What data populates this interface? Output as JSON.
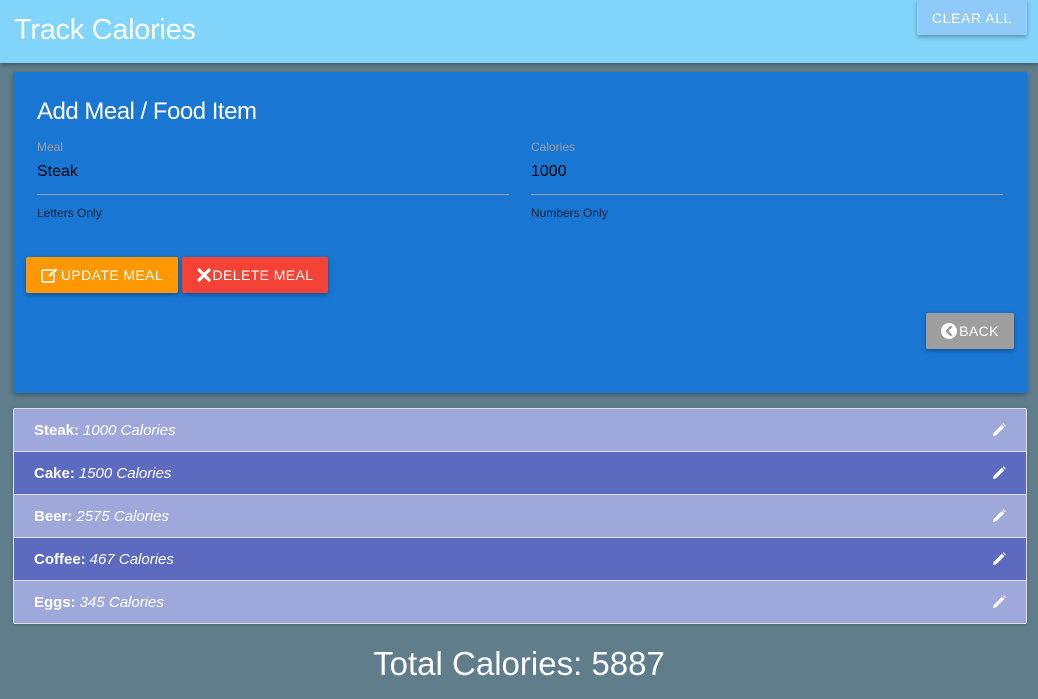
{
  "navbar": {
    "brand": "Track Calories",
    "clear_all_label": "CLEAR ALL"
  },
  "form": {
    "title": "Add Meal / Food Item",
    "meal": {
      "label": "Meal",
      "value": "Steak",
      "helper": "Letters Only"
    },
    "calories": {
      "label": "Calories",
      "value": "1000",
      "helper": "Numbers Only"
    },
    "update_label": "UPDATE MEAL",
    "delete_label": "DELETE MEAL",
    "back_label": "BACK"
  },
  "meals": [
    {
      "name": "Steak:",
      "calories": "1000 Calories"
    },
    {
      "name": "Cake:",
      "calories": "1500 Calories"
    },
    {
      "name": "Beer:",
      "calories": "2575 Calories"
    },
    {
      "name": "Coffee:",
      "calories": "467 Calories"
    },
    {
      "name": "Eggs:",
      "calories": "345 Calories"
    }
  ],
  "total_label": "Total Calories:",
  "total_value": "5887",
  "colors": {
    "background": "#607d8b",
    "navbar": "#81d4fa",
    "card": "#1976d2",
    "update": "#ff9800",
    "delete": "#f44336",
    "back": "#9e9e9e",
    "row_light": "#9fa8da",
    "row_dark": "#5c6bc0"
  },
  "icons": {
    "update": "edit-icon",
    "delete": "close-icon",
    "back": "chevron-left-circle-icon",
    "row_edit": "pencil-icon"
  }
}
